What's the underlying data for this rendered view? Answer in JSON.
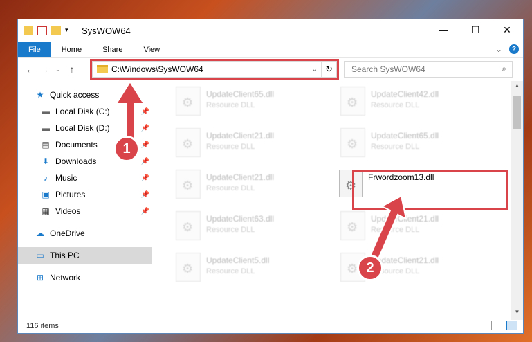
{
  "window": {
    "title": "SysWOW64"
  },
  "caption": {
    "minimize": "—",
    "maximize": "☐",
    "close": "✕"
  },
  "ribbon": {
    "tabs": [
      "File",
      "Home",
      "Share",
      "View"
    ],
    "expand": "⌄",
    "help": "?"
  },
  "nav": {
    "back": "←",
    "forward": "→",
    "recent": "⌄",
    "up": "↑"
  },
  "address": {
    "path": "C:\\Windows\\SysWOW64",
    "dropdown": "⌄",
    "refresh": "↻"
  },
  "search": {
    "placeholder": "Search SysWOW64",
    "icon": "search-icon"
  },
  "sidebar": {
    "items": [
      {
        "label": "Quick access",
        "icon": "star-icon",
        "glyph": "★",
        "pinned": false
      },
      {
        "label": "Local Disk (C:)",
        "icon": "drive-icon",
        "glyph": "▬",
        "pinned": true
      },
      {
        "label": "Local Disk (D:)",
        "icon": "drive-icon",
        "glyph": "▬",
        "pinned": true
      },
      {
        "label": "Documents",
        "icon": "documents-icon",
        "glyph": "▤",
        "pinned": true
      },
      {
        "label": "Downloads",
        "icon": "download-icon",
        "glyph": "⬇",
        "pinned": true
      },
      {
        "label": "Music",
        "icon": "music-icon",
        "glyph": "♪",
        "pinned": true
      },
      {
        "label": "Pictures",
        "icon": "pictures-icon",
        "glyph": "▣",
        "pinned": true
      },
      {
        "label": "Videos",
        "icon": "videos-icon",
        "glyph": "▦",
        "pinned": true
      },
      {
        "label": "OneDrive",
        "icon": "cloud-icon",
        "glyph": "☁",
        "pinned": false
      },
      {
        "label": "This PC",
        "icon": "computer-icon",
        "glyph": "▭",
        "pinned": false
      },
      {
        "label": "Network",
        "icon": "network-icon",
        "glyph": "⊞",
        "pinned": false
      }
    ]
  },
  "files": [
    {
      "name": "UpdateClient65.dll",
      "desc": "Resource DLL"
    },
    {
      "name": "UpdateClient42.dll",
      "desc": "Resource DLL"
    },
    {
      "name": "UpdateClient21.dll",
      "desc": "Resource DLL"
    },
    {
      "name": "UpdateClient65.dll",
      "desc": "Resource DLL"
    },
    {
      "name": "UpdateClient21.dll",
      "desc": "Resource DLL"
    },
    {
      "name": "Frwordzoom13.dll",
      "desc": ""
    },
    {
      "name": "UpdateClient63.dll",
      "desc": "Resource DLL"
    },
    {
      "name": "UpdateClient21.dll",
      "desc": "Resource DLL"
    },
    {
      "name": "UpdateClient5.dll",
      "desc": "Resource DLL"
    },
    {
      "name": "UpdateClient21.dll",
      "desc": "Resource DLL"
    }
  ],
  "status": {
    "count": "116 items"
  },
  "badges": [
    "1",
    "2"
  ],
  "colors": {
    "accent": "#1979ca",
    "callout": "#d9434a"
  }
}
